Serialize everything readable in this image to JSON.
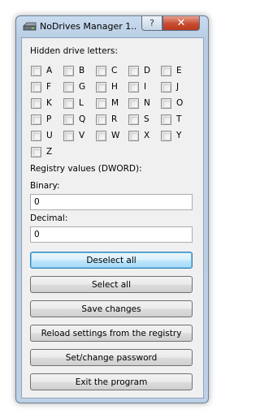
{
  "window": {
    "title": "NoDrives Manager 1....",
    "help_label": "?",
    "close_label": "✕"
  },
  "hidden_drives": {
    "label": "Hidden drive letters:",
    "letters": [
      "A",
      "B",
      "C",
      "D",
      "E",
      "F",
      "G",
      "H",
      "I",
      "J",
      "K",
      "L",
      "M",
      "N",
      "O",
      "P",
      "Q",
      "R",
      "S",
      "T",
      "U",
      "V",
      "W",
      "X",
      "Y",
      "Z"
    ]
  },
  "registry": {
    "label": "Registry values (DWORD):",
    "binary_label": "Binary:",
    "binary_value": "0",
    "decimal_label": "Decimal:",
    "decimal_value": "0"
  },
  "buttons": {
    "deselect_all": "Deselect all",
    "select_all": "Select all",
    "save_changes": "Save changes",
    "reload": "Reload settings from the registry",
    "set_password": "Set/change password",
    "exit": "Exit the program"
  }
}
